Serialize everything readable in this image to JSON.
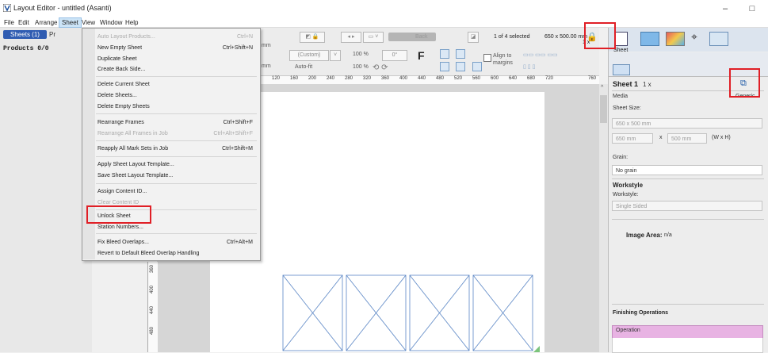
{
  "window": {
    "title": "Layout Editor - untitled (Asanti)",
    "minimize": "–",
    "maximize": "□"
  },
  "menubar": [
    "File",
    "Edit",
    "Arrange",
    "Sheet",
    "View",
    "Window",
    "Help"
  ],
  "left_pane": {
    "tab_sheets": "Sheets (1)",
    "tab_partial": "Pr",
    "products": "Products 0/0"
  },
  "toolbar": {
    "custom": "(Custom)",
    "zoom1": "100 %",
    "zoom2": "100 %",
    "autofit": "Auto-fit",
    "mm1": "mm",
    "mm2": "mm",
    "angle": "0°",
    "back": "Back",
    "selected": "1 of 4 selected",
    "size": "650 x 500.00 mm",
    "count": "1 x",
    "align_to": "Align to",
    "margins": "margins",
    "f_label": "F"
  },
  "ruler": [
    "120",
    "160",
    "200",
    "240",
    "280",
    "320",
    "360",
    "400",
    "440",
    "480",
    "520",
    "560",
    "600",
    "640",
    "680",
    "720",
    "760"
  ],
  "vruler": [
    "360",
    "400",
    "440",
    "480"
  ],
  "sheet_menu": {
    "items": [
      {
        "label": "Auto Layout Products...",
        "shortcut": "Ctrl+N",
        "disabled": true
      },
      {
        "label": "New Empty Sheet",
        "shortcut": "Ctrl+Shift+N",
        "disabled": false
      },
      {
        "label": "Duplicate Sheet",
        "shortcut": "",
        "disabled": false
      },
      {
        "label": "Create Back Side...",
        "shortcut": "",
        "disabled": false
      },
      {
        "label": "Delete Current Sheet",
        "shortcut": "",
        "disabled": false
      },
      {
        "label": "Delete Sheets...",
        "shortcut": "",
        "disabled": false
      },
      {
        "label": "Delete Empty Sheets",
        "shortcut": "",
        "disabled": false
      },
      {
        "label": "Rearrange Frames",
        "shortcut": "Ctrl+Shift+F",
        "disabled": false
      },
      {
        "label": "Rearrange All Frames in Job",
        "shortcut": "Ctrl+Alt+Shift+F",
        "disabled": true
      },
      {
        "label": "Reapply All Mark Sets in Job",
        "shortcut": "Ctrl+Shift+M",
        "disabled": false
      },
      {
        "label": "Apply Sheet Layout Template...",
        "shortcut": "",
        "disabled": false
      },
      {
        "label": "Save Sheet Layout Template...",
        "shortcut": "",
        "disabled": false
      },
      {
        "label": "Assign Content ID...",
        "shortcut": "",
        "disabled": false
      },
      {
        "label": "Clear Content ID",
        "shortcut": "",
        "disabled": true
      },
      {
        "label": "Unlock Sheet",
        "shortcut": "",
        "disabled": false
      },
      {
        "label": "Station Numbers...",
        "shortcut": "",
        "disabled": false
      },
      {
        "label": "Fix Bleed Overlaps...",
        "shortcut": "Ctrl+Alt+M",
        "disabled": false
      },
      {
        "label": "Revert to Default Bleed Overlap Handling",
        "shortcut": "",
        "disabled": false
      }
    ]
  },
  "right_pane": {
    "tab_sheet": "Sheet",
    "sheet_title": "Sheet 1",
    "sheet_count": "1 x",
    "media_label": "Media",
    "media_value": "Generic",
    "sheet_size_label": "Sheet Size:",
    "sheet_size_value": "650 x 500 mm",
    "width": "650 mm",
    "x": "x",
    "height": "500 mm",
    "wxh": "(W x H)",
    "grain_label": "Grain:",
    "grain_value": "No grain",
    "workstyle_head": "Workstyle",
    "workstyle_label": "Workstyle:",
    "workstyle_value": "Single Sided",
    "image_area": "Image Area:",
    "image_area_value": "n/a",
    "finishing_head": "Finishing Operations",
    "operation_label": "Operation"
  },
  "colors": {
    "highlight": "#e01f26",
    "tab_blue": "#2f5cb2",
    "operation_pink": "#e8b3e3",
    "frame_blue": "#5a86c5"
  }
}
